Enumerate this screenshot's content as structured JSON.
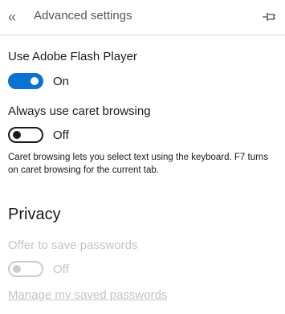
{
  "header": {
    "back_icon": "chevron-double-left",
    "title": "Advanced settings",
    "pin_icon": "pin"
  },
  "flash": {
    "label": "Use Adobe Flash Player",
    "enabled": true,
    "state": "On"
  },
  "caret": {
    "label": "Always use caret browsing",
    "enabled": false,
    "state": "Off",
    "description": "Caret browsing lets you select text using the keyboard. F7 turns on caret browsing for the current tab."
  },
  "privacy": {
    "heading": "Privacy",
    "offer_passwords": {
      "label": "Offer to save passwords",
      "enabled": false,
      "disabled": true,
      "state": "Off"
    },
    "manage_passwords_link": "Manage my saved passwords"
  },
  "colors": {
    "toggle_on": "#0a73d2",
    "disabled_text": "#c4c4c4"
  }
}
